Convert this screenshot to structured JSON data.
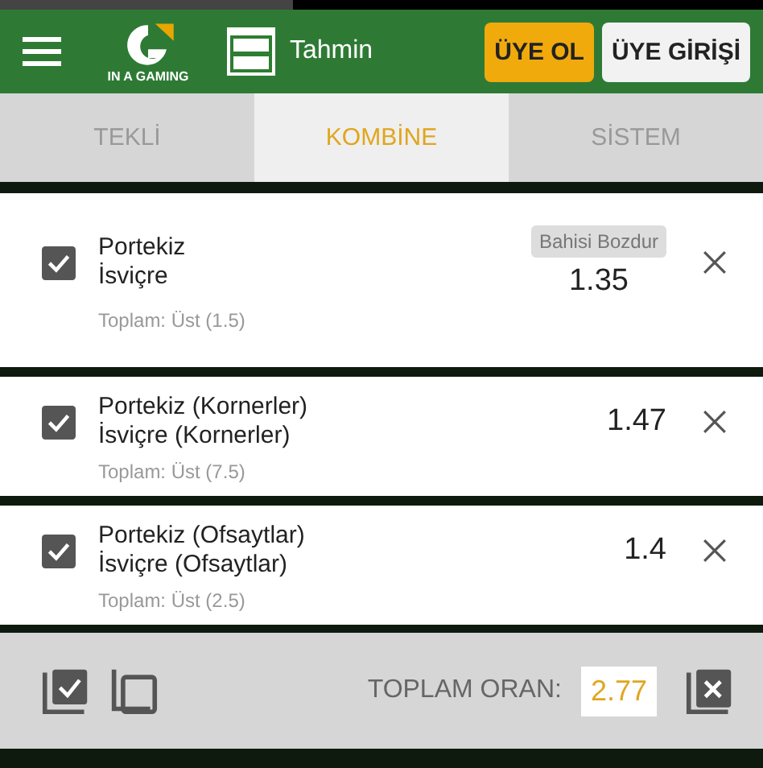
{
  "header": {
    "logo_text": "IN A GAMING",
    "title": "Tahmin",
    "buttons": [
      {
        "label": "ÜYE OL",
        "kind": "primary"
      },
      {
        "label": "ÜYE GİRİŞİ",
        "kind": "secondary"
      }
    ]
  },
  "tabs": [
    {
      "label": "TEKLİ",
      "selected": false
    },
    {
      "label": "KOMBİNE",
      "selected": true
    },
    {
      "label": "SİSTEM",
      "selected": false
    }
  ],
  "bets": [
    {
      "home": "Portekiz",
      "away": "İsviçre",
      "market": "Toplam: Üst (1.5)",
      "odds": "1.35",
      "checked": true,
      "badge": "Bahisi Bozdur"
    },
    {
      "home": "Portekiz (Kornerler)",
      "away": "İsviçre (Kornerler)",
      "market": "Toplam: Üst (7.5)",
      "odds": "1.47",
      "checked": true
    },
    {
      "home": "Portekiz (Ofsaytlar)",
      "away": "İsviçre (Ofsaytlar)",
      "market": "Toplam: Üst (2.5)",
      "odds": "1.4",
      "checked": true
    }
  ],
  "footer": {
    "total_label": "TOPLAM ORAN:",
    "total_value": "2.77"
  }
}
